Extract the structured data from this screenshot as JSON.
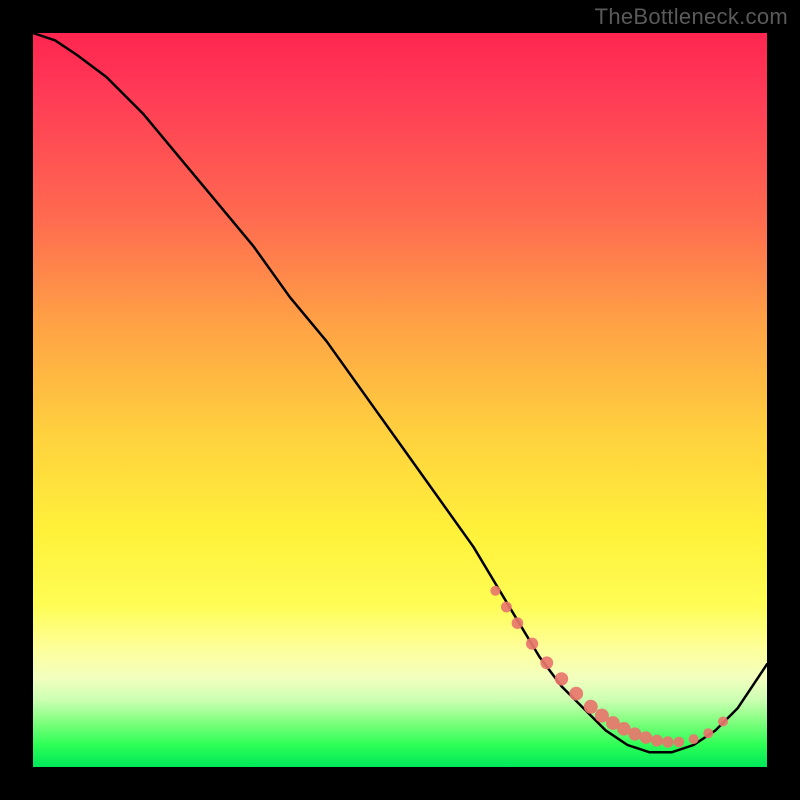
{
  "watermark": "TheBottleneck.com",
  "chart_data": {
    "type": "line",
    "title": "",
    "xlabel": "",
    "ylabel": "",
    "xlim": [
      0,
      100
    ],
    "ylim": [
      0,
      100
    ],
    "series": [
      {
        "name": "bottleneck-curve",
        "x": [
          0,
          3,
          6,
          10,
          15,
          20,
          25,
          30,
          35,
          40,
          45,
          50,
          55,
          60,
          63,
          66,
          69,
          72,
          75,
          78,
          81,
          84,
          87,
          90,
          93,
          96,
          100
        ],
        "values": [
          100,
          99,
          97,
          94,
          89,
          83,
          77,
          71,
          64,
          58,
          51,
          44,
          37,
          30,
          25,
          20,
          15,
          11,
          8,
          5,
          3,
          2,
          2,
          3,
          5,
          8,
          14
        ]
      }
    ],
    "markers": {
      "name": "highlight-dots",
      "x": [
        63.0,
        64.5,
        66.0,
        68.0,
        70.0,
        72.0,
        74.0,
        76.0,
        77.5,
        79.0,
        80.5,
        82.0,
        83.5,
        85.0,
        86.5,
        88.0,
        90.0,
        92.0,
        94.0
      ],
      "values": [
        24.0,
        21.8,
        19.6,
        16.8,
        14.2,
        12.0,
        10.0,
        8.2,
        7.0,
        6.0,
        5.2,
        4.5,
        4.0,
        3.6,
        3.4,
        3.4,
        3.8,
        4.6,
        6.2
      ]
    },
    "gradient_stops": [
      {
        "pct": 0,
        "color": "#ff2550"
      },
      {
        "pct": 25,
        "color": "#ff6a50"
      },
      {
        "pct": 55,
        "color": "#ffd23e"
      },
      {
        "pct": 78,
        "color": "#fffd55"
      },
      {
        "pct": 94,
        "color": "#7cff7c"
      },
      {
        "pct": 100,
        "color": "#00e85a"
      }
    ]
  }
}
